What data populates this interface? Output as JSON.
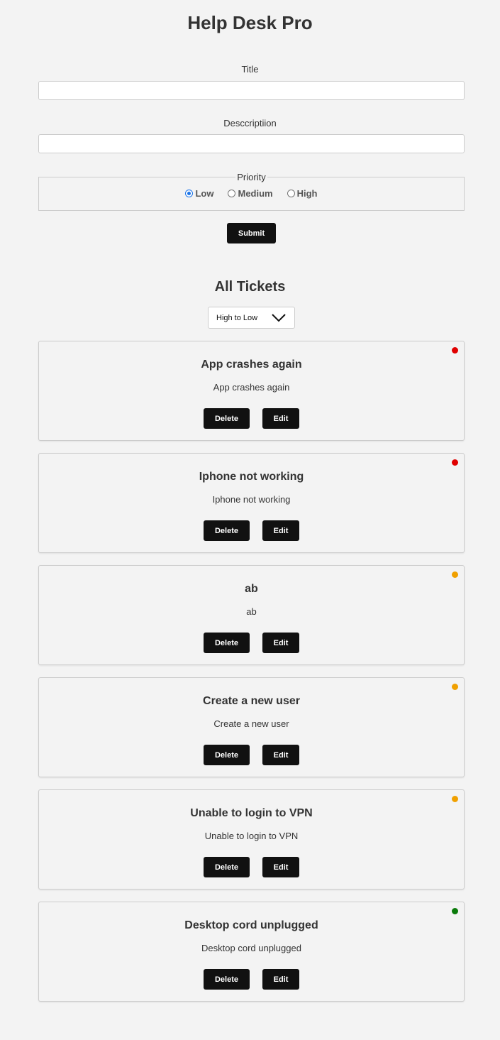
{
  "header": {
    "title": "Help Desk Pro"
  },
  "form": {
    "title_label": "Title",
    "title_value": "",
    "description_label": "Desccriptiion",
    "description_value": "",
    "priority_legend": "Priority",
    "priority_options": [
      {
        "label": "Low",
        "checked": true
      },
      {
        "label": "Medium",
        "checked": false
      },
      {
        "label": "High",
        "checked": false
      }
    ],
    "submit_label": "Submit"
  },
  "tickets_section": {
    "heading": "All Tickets",
    "sort_value": "High to Low"
  },
  "colors": {
    "high": "#e00000",
    "medium": "#f0a000",
    "low": "#0a7a0a"
  },
  "tickets": [
    {
      "title": "App crashes again",
      "description": "App crashes again",
      "priority": "high",
      "delete_label": "Delete",
      "edit_label": "Edit"
    },
    {
      "title": "Iphone not working",
      "description": "Iphone not working",
      "priority": "high",
      "delete_label": "Delete",
      "edit_label": "Edit"
    },
    {
      "title": "ab",
      "description": "ab",
      "priority": "medium",
      "delete_label": "Delete",
      "edit_label": "Edit"
    },
    {
      "title": "Create a new user",
      "description": "Create a new user",
      "priority": "medium",
      "delete_label": "Delete",
      "edit_label": "Edit"
    },
    {
      "title": "Unable to login to VPN",
      "description": "Unable to login to VPN",
      "priority": "medium",
      "delete_label": "Delete",
      "edit_label": "Edit"
    },
    {
      "title": "Desktop cord unplugged",
      "description": "Desktop cord unplugged",
      "priority": "low",
      "delete_label": "Delete",
      "edit_label": "Edit"
    }
  ]
}
